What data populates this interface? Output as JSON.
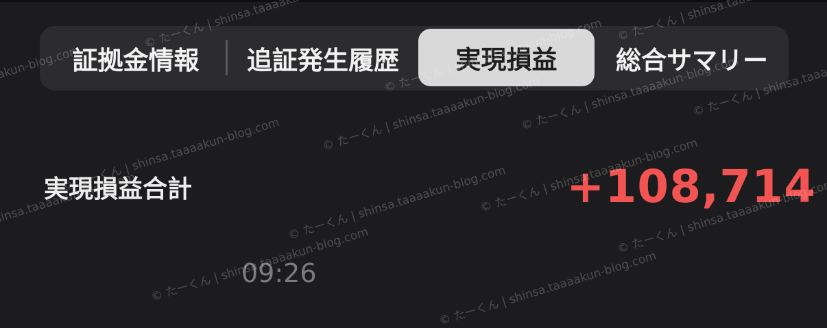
{
  "tabs": [
    {
      "label": "証拠金情報",
      "selected": false
    },
    {
      "label": "追証発生履歴",
      "selected": false
    },
    {
      "label": "実現損益",
      "selected": true
    },
    {
      "label": "総合サマリー",
      "selected": false
    }
  ],
  "summary": {
    "label": "実現損益合計",
    "value": "+108,714"
  },
  "timestamp": "09:26",
  "watermark": "© たーくん | shinsa.taaaakun-blog.com",
  "colors": {
    "background": "#1c1c1e",
    "tab_bar": "#2c2c2e",
    "tab_selected": "#d9d9da",
    "profit": "#f25454"
  }
}
